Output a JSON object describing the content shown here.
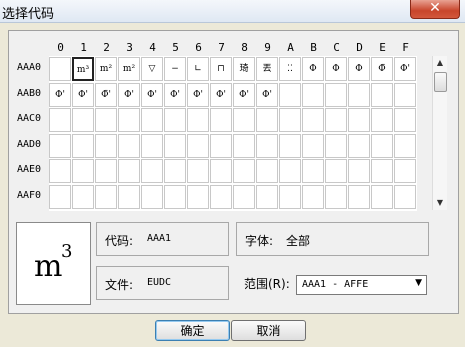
{
  "window": {
    "title": "选择代码",
    "close_label": "✕"
  },
  "grid": {
    "column_headers": [
      "0",
      "1",
      "2",
      "3",
      "4",
      "5",
      "6",
      "7",
      "8",
      "9",
      "A",
      "B",
      "C",
      "D",
      "E",
      "F"
    ],
    "rows": [
      {
        "label": "AAA0",
        "cells": [
          "",
          "m³",
          "m²",
          "m²",
          "▽",
          "−",
          "∟",
          "⊓",
          "琦",
          "丟",
          "⁚⁚",
          "Φ",
          "Φ",
          "Φ",
          "Φ̄",
          "Φ'"
        ]
      },
      {
        "label": "AAB0",
        "cells": [
          "Φ'",
          "Φ'",
          "Φ̄'",
          "Φ'",
          "Φ'",
          "Φ'",
          "Φ'",
          "Φ'",
          "Φ'",
          "Φ'",
          "",
          "",
          "",
          "",
          "",
          ""
        ]
      },
      {
        "label": "AAC0",
        "cells": [
          "",
          "",
          "",
          "",
          "",
          "",
          "",
          "",
          "",
          "",
          "",
          "",
          "",
          "",
          "",
          ""
        ]
      },
      {
        "label": "AAD0",
        "cells": [
          "",
          "",
          "",
          "",
          "",
          "",
          "",
          "",
          "",
          "",
          "",
          "",
          "",
          "",
          "",
          ""
        ]
      },
      {
        "label": "AAE0",
        "cells": [
          "",
          "",
          "",
          "",
          "",
          "",
          "",
          "",
          "",
          "",
          "",
          "",
          "",
          "",
          "",
          ""
        ]
      },
      {
        "label": "AAF0",
        "cells": [
          "",
          "",
          "",
          "",
          "",
          "",
          "",
          "",
          "",
          "",
          "",
          "",
          "",
          "",
          "",
          ""
        ]
      }
    ],
    "selected_cell": "AAA1"
  },
  "preview": {
    "base": "m",
    "superscript": "3"
  },
  "info": {
    "code_label": "代码:",
    "code_value": "AAA1",
    "font_label": "字体:",
    "font_value": "全部",
    "file_label": "文件:",
    "file_value": "EUDC",
    "range_label": "范围(R):",
    "range_value": "AAA1 - AFFE"
  },
  "buttons": {
    "ok": "确定",
    "cancel": "取消"
  },
  "scrollbar": {
    "up_icon": "arrow-up-icon",
    "down_icon": "arrow-down-icon"
  }
}
